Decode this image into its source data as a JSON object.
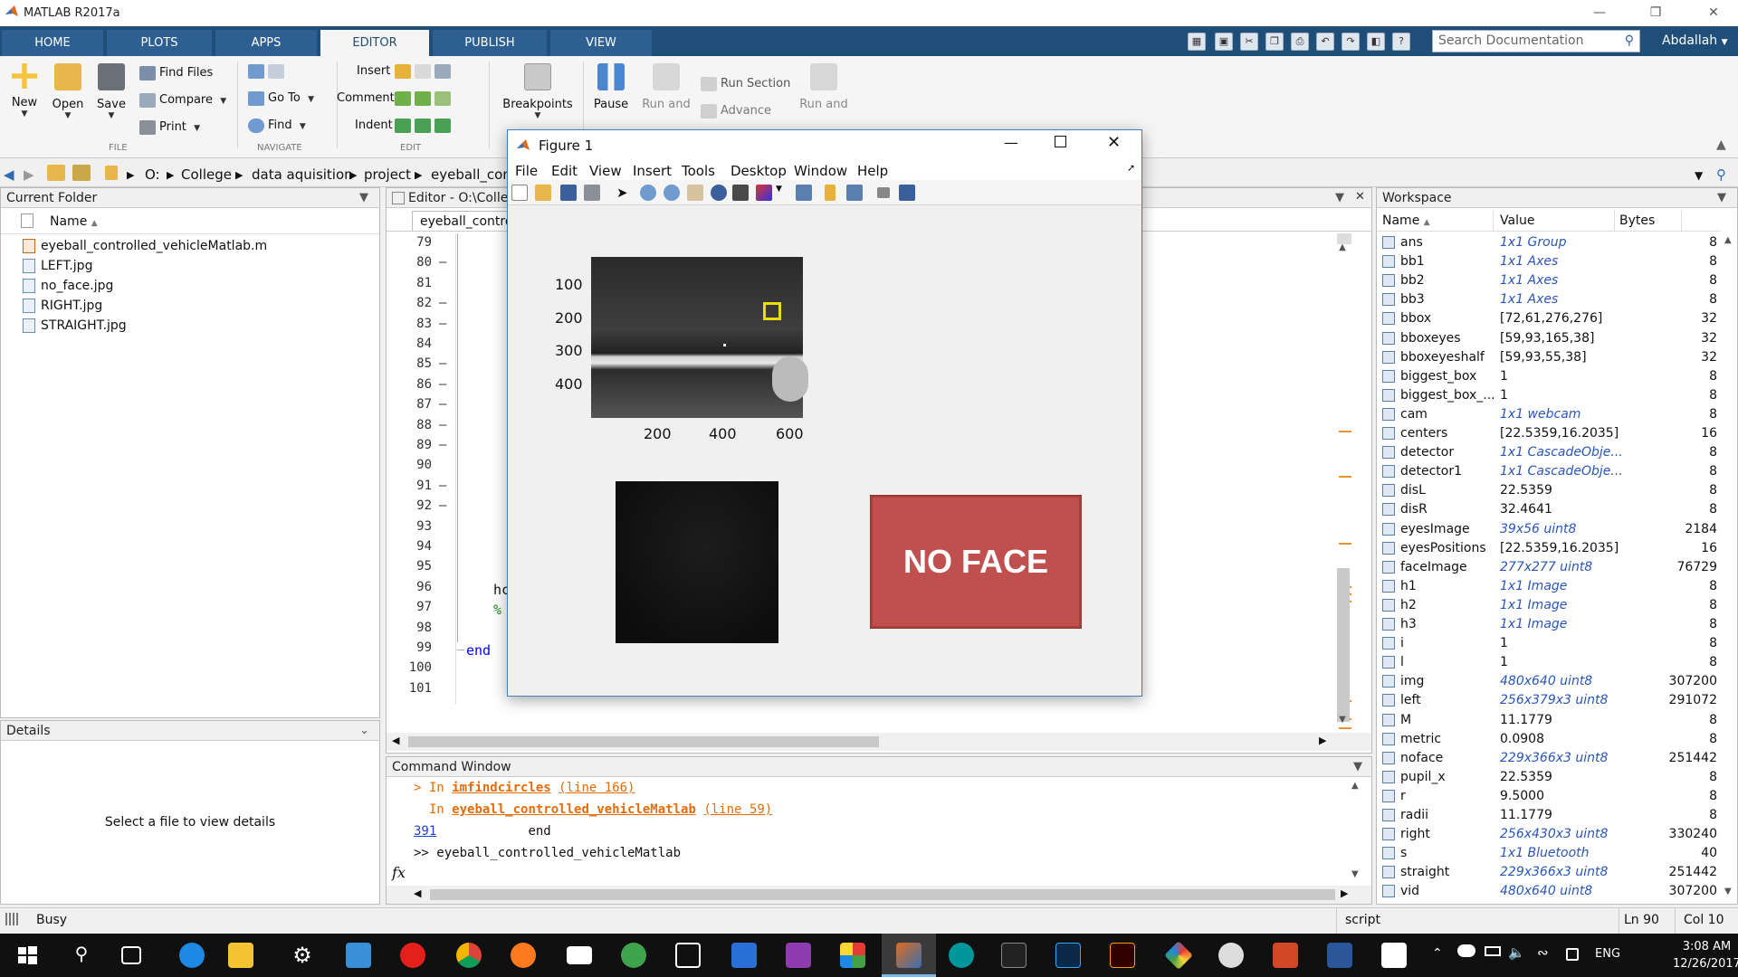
{
  "app": {
    "title": "MATLAB R2017a"
  },
  "ribbon_tabs": [
    "HOME",
    "PLOTS",
    "APPS",
    "EDITOR",
    "PUBLISH",
    "VIEW"
  ],
  "search": {
    "placeholder": "Search Documentation"
  },
  "user": "Abdallah",
  "toolstrip": {
    "new": "New",
    "open": "Open",
    "save": "Save",
    "find_files": "Find Files",
    "compare": "Compare",
    "print": "Print",
    "go_to": "Go To",
    "find": "Find",
    "insert": "Insert",
    "comment": "Comment",
    "indent": "Indent",
    "breakpoints": "Breakpoints",
    "pause": "Pause",
    "run_and_advance": "Run and Advance",
    "run_section": "Run Section",
    "advance": "Advance",
    "run_and_time": "Run and Time",
    "groups": {
      "file": "FILE",
      "navigate": "NAVIGATE",
      "edit": "EDIT"
    }
  },
  "address": [
    "O:",
    "College",
    "data aquisition",
    "project",
    "eyeball_cont"
  ],
  "current_folder": {
    "title": "Current Folder",
    "column": "Name",
    "files": [
      "eyeball_controlled_vehicleMatlab.m",
      "LEFT.jpg",
      "no_face.jpg",
      "RIGHT.jpg",
      "STRAIGHT.jpg"
    ]
  },
  "details": {
    "title": "Details",
    "message": "Select a file to view details"
  },
  "editor": {
    "title": "Editor - O:\\Colle",
    "tab": "eyeball_contro",
    "line_numbers": [
      "79",
      "80",
      "81",
      "82",
      "83",
      "84",
      "85",
      "86",
      "87",
      "88",
      "89",
      "90",
      "91",
      "92",
      "93",
      "94",
      "95",
      "96",
      "97",
      "98",
      "99",
      "100",
      "101"
    ],
    "dash_lines": [
      "80",
      "82",
      "83",
      "85",
      "86",
      "87",
      "88",
      "89",
      "91",
      "92"
    ],
    "code_95": "hc",
    "code_96": "%",
    "code_98": "end"
  },
  "command_window": {
    "title": "Command Window",
    "line1_prefix": "> In ",
    "line1_fn": "imfindcircles",
    "line1_ref": "(line 166)",
    "line2_prefix": "  In ",
    "line2_fn": "eyeball_controlled_vehicleMatlab",
    "line2_ref": "(line 59)",
    "line3_num": "391",
    "line3_text": "end",
    "prompt": ">> eyeball_controlled_vehicleMatlab"
  },
  "workspace": {
    "title": "Workspace",
    "columns": [
      "Name",
      "Value",
      "Bytes"
    ],
    "rows": [
      {
        "name": "ans",
        "value": "1x1 Group",
        "bytes": "8",
        "obj": true
      },
      {
        "name": "bb1",
        "value": "1x1 Axes",
        "bytes": "8",
        "obj": true
      },
      {
        "name": "bb2",
        "value": "1x1 Axes",
        "bytes": "8",
        "obj": true
      },
      {
        "name": "bb3",
        "value": "1x1 Axes",
        "bytes": "8",
        "obj": true
      },
      {
        "name": "bbox",
        "value": "[72,61,276,276]",
        "bytes": "32",
        "obj": false
      },
      {
        "name": "bboxeyes",
        "value": "[59,93,165,38]",
        "bytes": "32",
        "obj": false
      },
      {
        "name": "bboxeyeshalf",
        "value": "[59,93,55,38]",
        "bytes": "32",
        "obj": false
      },
      {
        "name": "biggest_box",
        "value": "1",
        "bytes": "8",
        "obj": false
      },
      {
        "name": "biggest_box_...",
        "value": "1",
        "bytes": "8",
        "obj": false
      },
      {
        "name": "cam",
        "value": "1x1 webcam",
        "bytes": "8",
        "obj": true
      },
      {
        "name": "centers",
        "value": "[22.5359,16.2035]",
        "bytes": "16",
        "obj": false
      },
      {
        "name": "detector",
        "value": "1x1 CascadeObje...",
        "bytes": "8",
        "obj": true
      },
      {
        "name": "detector1",
        "value": "1x1 CascadeObje...",
        "bytes": "8",
        "obj": true
      },
      {
        "name": "disL",
        "value": "22.5359",
        "bytes": "8",
        "obj": false
      },
      {
        "name": "disR",
        "value": "32.4641",
        "bytes": "8",
        "obj": false
      },
      {
        "name": "eyesImage",
        "value": "39x56 uint8",
        "bytes": "2184",
        "obj": true
      },
      {
        "name": "eyesPositions",
        "value": "[22.5359,16.2035]",
        "bytes": "16",
        "obj": false
      },
      {
        "name": "faceImage",
        "value": "277x277 uint8",
        "bytes": "76729",
        "obj": true
      },
      {
        "name": "h1",
        "value": "1x1 Image",
        "bytes": "8",
        "obj": true
      },
      {
        "name": "h2",
        "value": "1x1 Image",
        "bytes": "8",
        "obj": true
      },
      {
        "name": "h3",
        "value": "1x1 Image",
        "bytes": "8",
        "obj": true
      },
      {
        "name": "i",
        "value": "1",
        "bytes": "8",
        "obj": false
      },
      {
        "name": "l",
        "value": "1",
        "bytes": "8",
        "obj": false
      },
      {
        "name": "img",
        "value": "480x640 uint8",
        "bytes": "307200",
        "obj": true
      },
      {
        "name": "left",
        "value": "256x379x3 uint8",
        "bytes": "291072",
        "obj": true
      },
      {
        "name": "M",
        "value": "11.1779",
        "bytes": "8",
        "obj": false
      },
      {
        "name": "metric",
        "value": "0.0908",
        "bytes": "8",
        "obj": false
      },
      {
        "name": "noface",
        "value": "229x366x3 uint8",
        "bytes": "251442",
        "obj": true
      },
      {
        "name": "pupil_x",
        "value": "22.5359",
        "bytes": "8",
        "obj": false
      },
      {
        "name": "r",
        "value": "9.5000",
        "bytes": "8",
        "obj": false
      },
      {
        "name": "radii",
        "value": "11.1779",
        "bytes": "8",
        "obj": false
      },
      {
        "name": "right",
        "value": "256x430x3 uint8",
        "bytes": "330240",
        "obj": true
      },
      {
        "name": "s",
        "value": "1x1 Bluetooth",
        "bytes": "40",
        "obj": true
      },
      {
        "name": "straight",
        "value": "229x366x3 uint8",
        "bytes": "251442",
        "obj": true
      },
      {
        "name": "vid",
        "value": "480x640 uint8",
        "bytes": "307200",
        "obj": true
      }
    ]
  },
  "status": {
    "left": "Busy",
    "mode": "script",
    "ln": "Ln  90",
    "col": "Col  10"
  },
  "figure": {
    "title": "Figure 1",
    "menu": [
      "File",
      "Edit",
      "View",
      "Insert",
      "Tools",
      "Desktop",
      "Window",
      "Help"
    ],
    "yticks": [
      "100",
      "200",
      "300",
      "400"
    ],
    "xticks": [
      "200",
      "400",
      "600"
    ],
    "noface_label": "NO FACE"
  },
  "taskbar": {
    "lang": "ENG",
    "time": "3:08 AM",
    "date": "12/26/2017"
  },
  "colors": {
    "ribbon_blue": "#1f4e79",
    "noface_red": "#c0504d",
    "link_orange": "#e46c0a",
    "link_blue": "#1f3fd0",
    "keyword_blue": "#0000ff"
  }
}
